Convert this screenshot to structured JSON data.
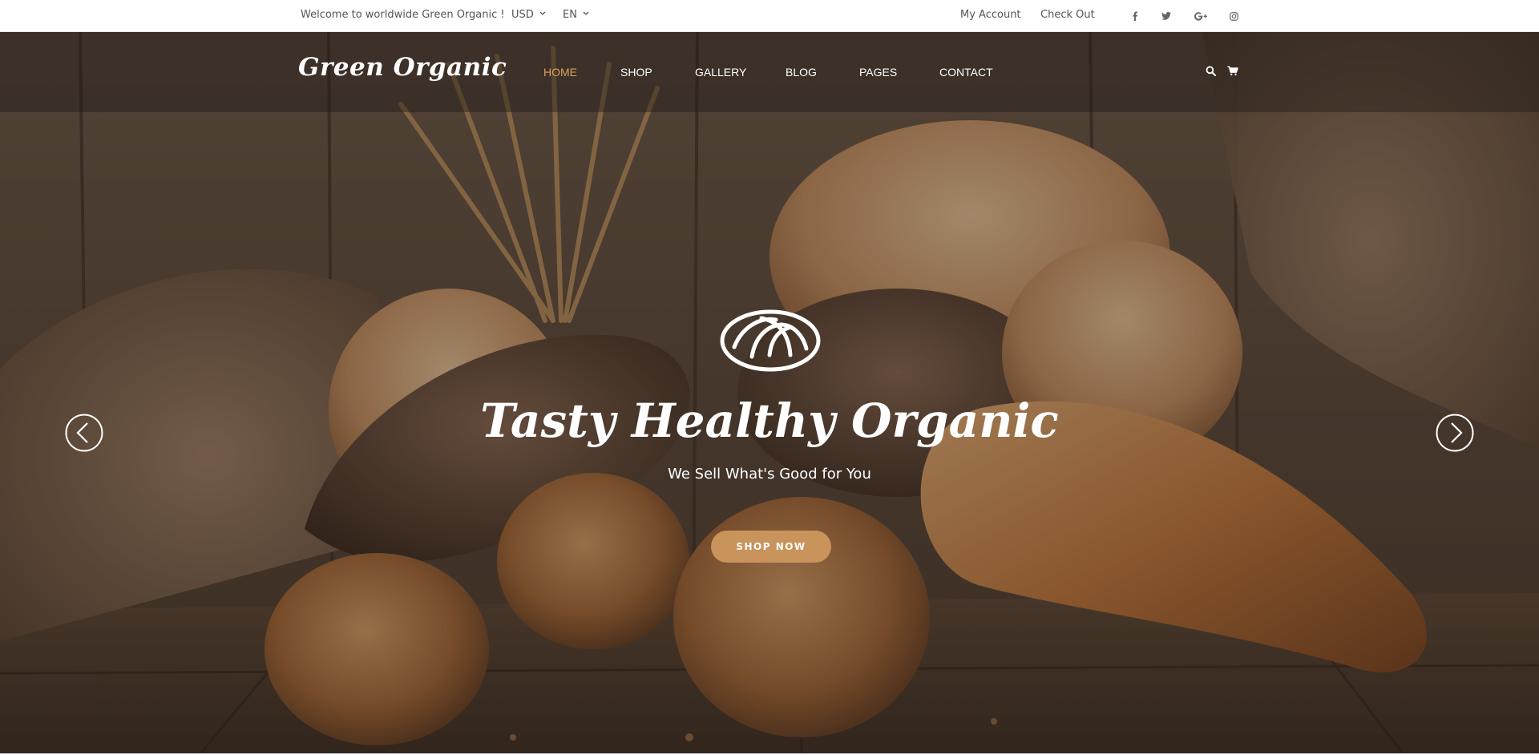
{
  "topbar": {
    "welcome": "Welcome to worldwide Green Organic !",
    "currency": "USD",
    "language": "EN",
    "my_account": "My Account",
    "check_out": "Check Out",
    "social_icons": [
      "facebook-icon",
      "twitter-icon",
      "google-plus-icon",
      "instagram-icon"
    ]
  },
  "header": {
    "logo": "Green Organic",
    "nav": [
      {
        "label": "HOME",
        "active": true
      },
      {
        "label": "SHOP",
        "active": false
      },
      {
        "label": "GALLERY",
        "active": false
      },
      {
        "label": "BLOG",
        "active": false
      },
      {
        "label": "PAGES",
        "active": false
      },
      {
        "label": "CONTACT",
        "active": false
      }
    ],
    "icons": [
      "search-icon",
      "cart-icon"
    ]
  },
  "hero": {
    "title": "Tasty Healthy Organic",
    "subtitle": "We Sell What's Good for You",
    "button": "SHOP NOW",
    "icons": [
      "bread-icon",
      "arrow-left-icon",
      "arrow-right-icon"
    ]
  },
  "colors": {
    "accent": "#d8a05e",
    "button": "#c9935c",
    "topbar_text": "#555555"
  }
}
